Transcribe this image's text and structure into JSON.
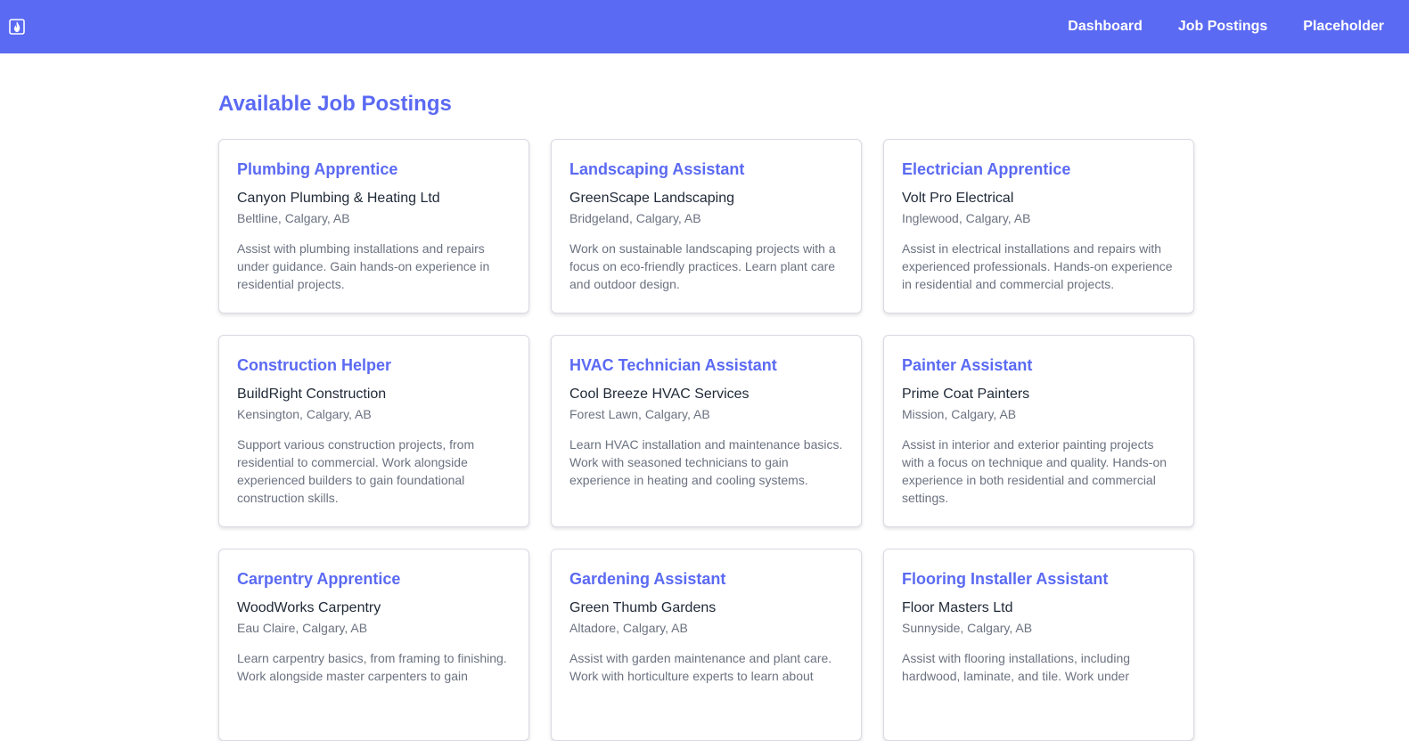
{
  "nav": {
    "logo_icon": "flame-logo-icon",
    "links": [
      "Dashboard",
      "Job Postings",
      "Placeholder"
    ]
  },
  "main": {
    "title": "Available Job Postings",
    "jobs": [
      {
        "title": "Plumbing Apprentice",
        "company": "Canyon Plumbing & Heating Ltd",
        "location": "Beltline, Calgary, AB",
        "description": "Assist with plumbing installations and repairs under guidance. Gain hands-on experience in residential projects."
      },
      {
        "title": "Landscaping Assistant",
        "company": "GreenScape Landscaping",
        "location": "Bridgeland, Calgary, AB",
        "description": "Work on sustainable landscaping projects with a focus on eco-friendly practices. Learn plant care and outdoor design."
      },
      {
        "title": "Electrician Apprentice",
        "company": "Volt Pro Electrical",
        "location": "Inglewood, Calgary, AB",
        "description": "Assist in electrical installations and repairs with experienced professionals. Hands-on experience in residential and commercial projects."
      },
      {
        "title": "Construction Helper",
        "company": "BuildRight Construction",
        "location": "Kensington, Calgary, AB",
        "description": "Support various construction projects, from residential to commercial. Work alongside experienced builders to gain foundational construction skills."
      },
      {
        "title": "HVAC Technician Assistant",
        "company": "Cool Breeze HVAC Services",
        "location": "Forest Lawn, Calgary, AB",
        "description": "Learn HVAC installation and maintenance basics. Work with seasoned technicians to gain experience in heating and cooling systems."
      },
      {
        "title": "Painter Assistant",
        "company": "Prime Coat Painters",
        "location": "Mission, Calgary, AB",
        "description": "Assist in interior and exterior painting projects with a focus on technique and quality. Hands-on experience in both residential and commercial settings."
      },
      {
        "title": "Carpentry Apprentice",
        "company": "WoodWorks Carpentry",
        "location": "Eau Claire, Calgary, AB",
        "description": "Learn carpentry basics, from framing to finishing. Work alongside master carpenters to gain"
      },
      {
        "title": "Gardening Assistant",
        "company": "Green Thumb Gardens",
        "location": "Altadore, Calgary, AB",
        "description": "Assist with garden maintenance and plant care. Work with horticulture experts to learn about"
      },
      {
        "title": "Flooring Installer Assistant",
        "company": "Floor Masters Ltd",
        "location": "Sunnyside, Calgary, AB",
        "description": "Assist with flooring installations, including hardwood, laminate, and tile. Work under"
      }
    ]
  },
  "colors": {
    "primary": "#5b6af2",
    "text_dark": "#1f2937",
    "text_muted": "#6b7280",
    "card_border": "#d9dbe3"
  }
}
